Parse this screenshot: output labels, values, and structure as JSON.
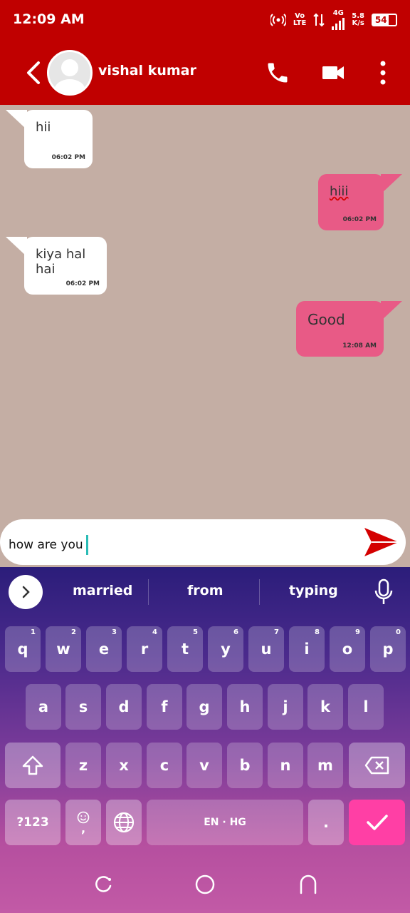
{
  "status": {
    "time": "12:09 AM",
    "volte_top": "Vo",
    "volte_bottom": "LTE",
    "network": "4G",
    "speed_value": "5.8",
    "speed_unit": "K/s",
    "battery": "54"
  },
  "header": {
    "contact_name": "vishal kumar"
  },
  "messages": [
    {
      "text": "hii",
      "time": "06:02 PM",
      "direction": "incoming"
    },
    {
      "text": "hiii",
      "time": "06:02 PM",
      "direction": "outgoing"
    },
    {
      "text": "kiya hal hai",
      "time": "06:02 PM",
      "direction": "incoming"
    },
    {
      "text": "Good",
      "time": "12:08 AM",
      "direction": "outgoing"
    }
  ],
  "composer": {
    "value": "how are you"
  },
  "keyboard": {
    "suggestions": [
      "married",
      "from",
      "typing"
    ],
    "row1": [
      {
        "key": "q",
        "hint": "1"
      },
      {
        "key": "w",
        "hint": "2"
      },
      {
        "key": "e",
        "hint": "3"
      },
      {
        "key": "r",
        "hint": "4"
      },
      {
        "key": "t",
        "hint": "5"
      },
      {
        "key": "y",
        "hint": "6"
      },
      {
        "key": "u",
        "hint": "7"
      },
      {
        "key": "i",
        "hint": "8"
      },
      {
        "key": "o",
        "hint": "9"
      },
      {
        "key": "p",
        "hint": "0"
      }
    ],
    "row2": [
      "a",
      "s",
      "d",
      "f",
      "g",
      "h",
      "j",
      "k",
      "l"
    ],
    "row3": [
      "z",
      "x",
      "c",
      "v",
      "b",
      "n",
      "m"
    ],
    "symbols_label": "?123",
    "comma": ",",
    "space_label": "EN · HG",
    "period": "."
  },
  "colors": {
    "header": "#c00000",
    "chat_background": "#c4aea4",
    "outgoing_bubble": "#e85a86",
    "incoming_bubble": "#ffffff",
    "send_icon": "#d40000",
    "enter_key": "#ff3fa5"
  }
}
